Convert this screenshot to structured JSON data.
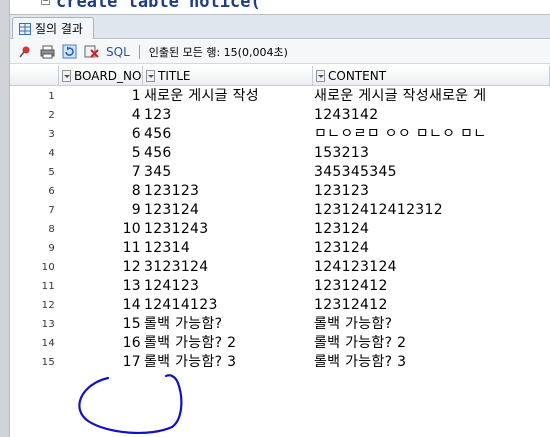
{
  "editor": {
    "code_line": "create table notice("
  },
  "tab": {
    "label": "질의 결과"
  },
  "toolbar": {
    "sql_label": "SQL",
    "status_text": "인출된 모든 행: 15(0,004초)"
  },
  "columns": [
    {
      "label": "BOARD_NO"
    },
    {
      "label": "TITLE"
    },
    {
      "label": "CONTENT"
    }
  ],
  "rows": [
    {
      "num": "1",
      "board_no": "1",
      "title": "새로운 게시글 작성",
      "content": "새로운 게시글 작성새로운 게"
    },
    {
      "num": "2",
      "board_no": "4",
      "title": "123",
      "content": "1243142"
    },
    {
      "num": "3",
      "board_no": "6",
      "title": "456",
      "content": "ㅁㄴㅇㄹㅁ ㅇㅇ ㅁㄴㅇ ㅁㄴ"
    },
    {
      "num": "4",
      "board_no": "5",
      "title": "456",
      "content": "153213"
    },
    {
      "num": "5",
      "board_no": "7",
      "title": "345",
      "content": "345345345"
    },
    {
      "num": "6",
      "board_no": "8",
      "title": "123123",
      "content": "123123"
    },
    {
      "num": "7",
      "board_no": "9",
      "title": "123124",
      "content": "12312412412312"
    },
    {
      "num": "8",
      "board_no": "10",
      "title": "1231243",
      "content": "123124"
    },
    {
      "num": "9",
      "board_no": "11",
      "title": "12314",
      "content": "123124"
    },
    {
      "num": "10",
      "board_no": "12",
      "title": "3123124",
      "content": "124123124"
    },
    {
      "num": "11",
      "board_no": "13",
      "title": "124123",
      "content": "12312412"
    },
    {
      "num": "12",
      "board_no": "14",
      "title": "12414123",
      "content": "12312412"
    },
    {
      "num": "13",
      "board_no": "15",
      "title": "롤백 가능함?",
      "content": "롤백 가능함?"
    },
    {
      "num": "14",
      "board_no": "16",
      "title": "롤백 가능함? 2",
      "content": "롤백 가능함? 2"
    },
    {
      "num": "15",
      "board_no": "17",
      "title": "롤백 가능함? 3",
      "content": "롤백 가능함? 3"
    }
  ],
  "colors": {
    "annotation": "#1010c8",
    "sql_blue": "#2a55a5",
    "code_blue": "#1f3c88"
  }
}
